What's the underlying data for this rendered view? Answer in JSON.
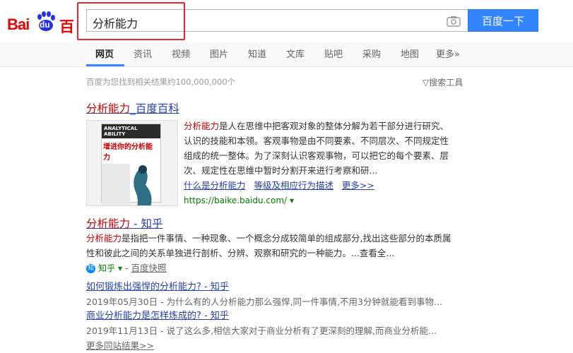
{
  "header": {
    "logo_text": "Bai du 百度",
    "query": "分析能力",
    "search_button": "百度一下"
  },
  "tabs": [
    "网页",
    "资讯",
    "视频",
    "图片",
    "知道",
    "文库",
    "贴吧",
    "采购",
    "地图",
    "更多»"
  ],
  "stats": "百度为您找到相关结果约100,000,000个",
  "tools": "搜索工具",
  "result1": {
    "title_em": "分析能力",
    "title_rest": "_百度百科",
    "snippet_line1_em": "分析能力",
    "snippet_line1_rest": "是人在思维中把客观对象的整体分解为若干部分进行研究、",
    "snippet_line2": "认识的技能和本领。客观事物是由不同要素、不同层次、不同规定性",
    "snippet_line3": "组成的统一整体。为了深刻认识客观事物，可以把它的每个要素、层",
    "snippet_line4": "次、规定性在思维中暂时分割开来进行考察和研...",
    "links": [
      "什么是分析能力",
      "等级及相应行为描述",
      "更多>>"
    ],
    "url": "https://baike.baidu.com/",
    "book_title": "ANALYTICAL ABILITY",
    "book_cn": "增进你的分析能力"
  },
  "result2": {
    "title_em": "分析能力",
    "title_rest": " - 知乎",
    "snippet_line1_em": "分析能力",
    "snippet_line1_rest": "是指把一件事情、一种现象、一个概念分成较简单的组成部分,找出这些部分的本质属",
    "snippet_line2": "性和彼此之间的关系单独进行剖析、分辨、观察和研究的一种能力。...查看全...",
    "source": "知乎",
    "snapshot": "百度快照",
    "sub1_title": "如何锻炼出强悍的分析能力? - 知乎",
    "sub1_desc": "2019年05月30日 - 为什么有的人分析能力那么强悍,同一件事情,不用3分钟就能看到事物...",
    "sub2_title": "商业分析能力是怎样炼成的? - 知乎",
    "sub2_desc": "2019年11月13日 - 说了这么多,相信大家对于商业分析有了更深刻的理解,而商业分析能...",
    "more": "更多同站结果>>"
  }
}
